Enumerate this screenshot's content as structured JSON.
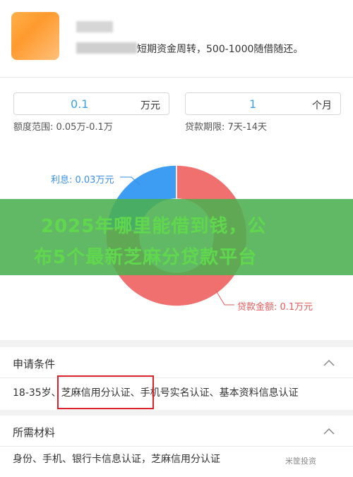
{
  "product": {
    "description": "短期资金周转，500-1000随借随还。"
  },
  "amount": {
    "value": "0.1",
    "unit": "万元",
    "range": "额度范围: 0.05万-0.1万"
  },
  "term": {
    "value": "1",
    "unit": "个月",
    "range": "贷款期限: 7天-14天"
  },
  "chart_data": {
    "type": "pie",
    "donut": true,
    "slices": [
      {
        "label": "利息: 0.03万元",
        "value": 0.03,
        "color": "#3d9df2"
      },
      {
        "label": "贷款金额: 0.1万元",
        "value": 0.1,
        "color": "#f07070"
      }
    ]
  },
  "banner": {
    "line1": "2025年哪里能借到钱，公",
    "line2": "布5个最新芝麻分贷款平台"
  },
  "conditions": {
    "title": "申请条件",
    "text": "18-35岁、芝麻信用分认证、手机号实名认证、基本资料信息认证"
  },
  "materials": {
    "title": "所需材料",
    "text": "身份、手机、银行卡信息认证，芝麻信用分认证"
  },
  "watermark": "米筐投资"
}
